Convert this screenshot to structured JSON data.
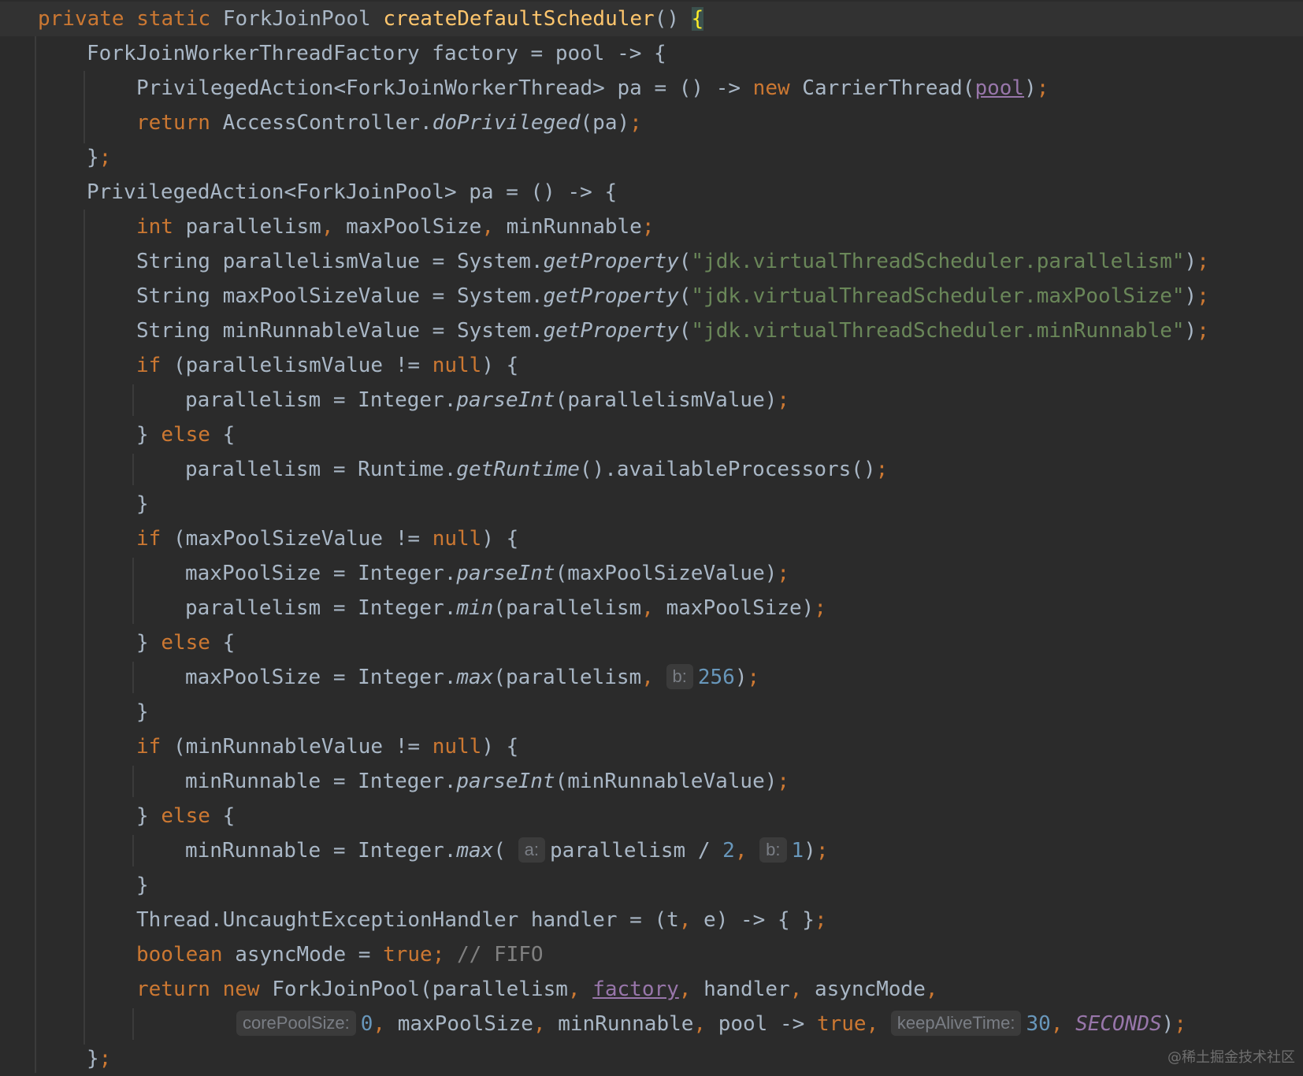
{
  "code": {
    "l1": {
      "mods": "private static ",
      "type": "ForkJoinPool ",
      "method": "createDefaultScheduler",
      "paren": "() ",
      "brace": "{"
    },
    "l2": {
      "text": "ForkJoinWorkerThreadFactory factory = pool -> {"
    },
    "l3": {
      "a": "PrivilegedAction<ForkJoinWorkerThread> pa = () -> ",
      "new": "new",
      "b": " CarrierThread(",
      "pool": "pool",
      "c": ")",
      "semi": ";"
    },
    "l4": {
      "ret": "return",
      "a": " AccessController.",
      "m": "doPrivileged",
      "b": "(pa)",
      "semi": ";"
    },
    "l5": {
      "a": "}",
      "semi": ";"
    },
    "l6": {
      "text": "PrivilegedAction<ForkJoinPool> pa = () -> {"
    },
    "l7": {
      "int": "int",
      "a": " parallelism",
      "c1": ",",
      "b": " maxPoolSize",
      "c2": ",",
      "c": " minRunnable",
      "semi": ";"
    },
    "l8": {
      "a": "String parallelismValue = System.",
      "m": "getProperty",
      "b": "(",
      "s": "\"jdk.virtualThreadScheduler.parallelism\"",
      "c": ")",
      "semi": ";"
    },
    "l9": {
      "a": "String maxPoolSizeValue = System.",
      "m": "getProperty",
      "b": "(",
      "s": "\"jdk.virtualThreadScheduler.maxPoolSize\"",
      "c": ")",
      "semi": ";"
    },
    "l10": {
      "a": "String minRunnableValue = System.",
      "m": "getProperty",
      "b": "(",
      "s": "\"jdk.virtualThreadScheduler.minRunnable\"",
      "c": ")",
      "semi": ";"
    },
    "l11": {
      "if": "if",
      "a": " (parallelismValue != ",
      "null": "null",
      "b": ") {"
    },
    "l12": {
      "a": "parallelism = Integer.",
      "m": "parseInt",
      "b": "(parallelismValue)",
      "semi": ";"
    },
    "l13": {
      "a": "} ",
      "else": "else",
      "b": " {"
    },
    "l14": {
      "a": "parallelism = Runtime.",
      "m": "getRuntime",
      "b": "().availableProcessors()",
      "semi": ";"
    },
    "l15": {
      "text": "}"
    },
    "l16": {
      "if": "if",
      "a": " (maxPoolSizeValue != ",
      "null": "null",
      "b": ") {"
    },
    "l17": {
      "a": "maxPoolSize = Integer.",
      "m": "parseInt",
      "b": "(maxPoolSizeValue)",
      "semi": ";"
    },
    "l18": {
      "a": "parallelism = Integer.",
      "m": "min",
      "b": "(parallelism",
      "c1": ",",
      "c": " maxPoolSize)",
      "semi": ";"
    },
    "l19": {
      "a": "} ",
      "else": "else",
      "b": " {"
    },
    "l20": {
      "a": "maxPoolSize = Integer.",
      "m": "max",
      "b": "(parallelism",
      "c1": ",",
      "hint": "b:",
      "num": "256",
      "c": ")",
      "semi": ";"
    },
    "l21": {
      "text": "}"
    },
    "l22": {
      "if": "if",
      "a": " (minRunnableValue != ",
      "null": "null",
      "b": ") {"
    },
    "l23": {
      "a": "minRunnable = Integer.",
      "m": "parseInt",
      "b": "(minRunnableValue)",
      "semi": ";"
    },
    "l24": {
      "a": "} ",
      "else": "else",
      "b": " {"
    },
    "l25": {
      "a": "minRunnable = Integer.",
      "m": "max",
      "b": "(",
      "hint1": "a:",
      "c": "parallelism / ",
      "num1": "2",
      "c1": ",",
      "hint2": "b:",
      "num2": "1",
      "d": ")",
      "semi": ";"
    },
    "l26": {
      "text": "}"
    },
    "l27": {
      "a": "Thread.UncaughtExceptionHandler handler = (t",
      "c1": ",",
      "b": " e) -> { }",
      "semi": ";"
    },
    "l28": {
      "bool": "boolean",
      "a": " asyncMode = ",
      "true": "true",
      "semi": ";",
      "comment": " // FIFO"
    },
    "l29": {
      "ret": "return",
      "sp": " ",
      "new": "new",
      "a": " ForkJoinPool(parallelism",
      "c1": ",",
      "sp2": " ",
      "factory": "factory",
      "c2": ",",
      "b": " handler",
      "c3": ",",
      "c": " asyncMode",
      "c4": ","
    },
    "l30": {
      "hint1": "corePoolSize:",
      "num1": "0",
      "c1": ",",
      "a": " maxPoolSize",
      "c2": ",",
      "b": " minRunnable",
      "c3": ",",
      "c": " pool -> ",
      "true": "true",
      "c4": ",",
      "hint2": "keepAliveTime:",
      "num2": "30",
      "c5": ",",
      "sp": " ",
      "seconds": "SECONDS",
      "d": ")",
      "semi": ";"
    },
    "l31": {
      "a": "}",
      "semi": ";"
    }
  },
  "watermark": "@稀土掘金技术社区"
}
